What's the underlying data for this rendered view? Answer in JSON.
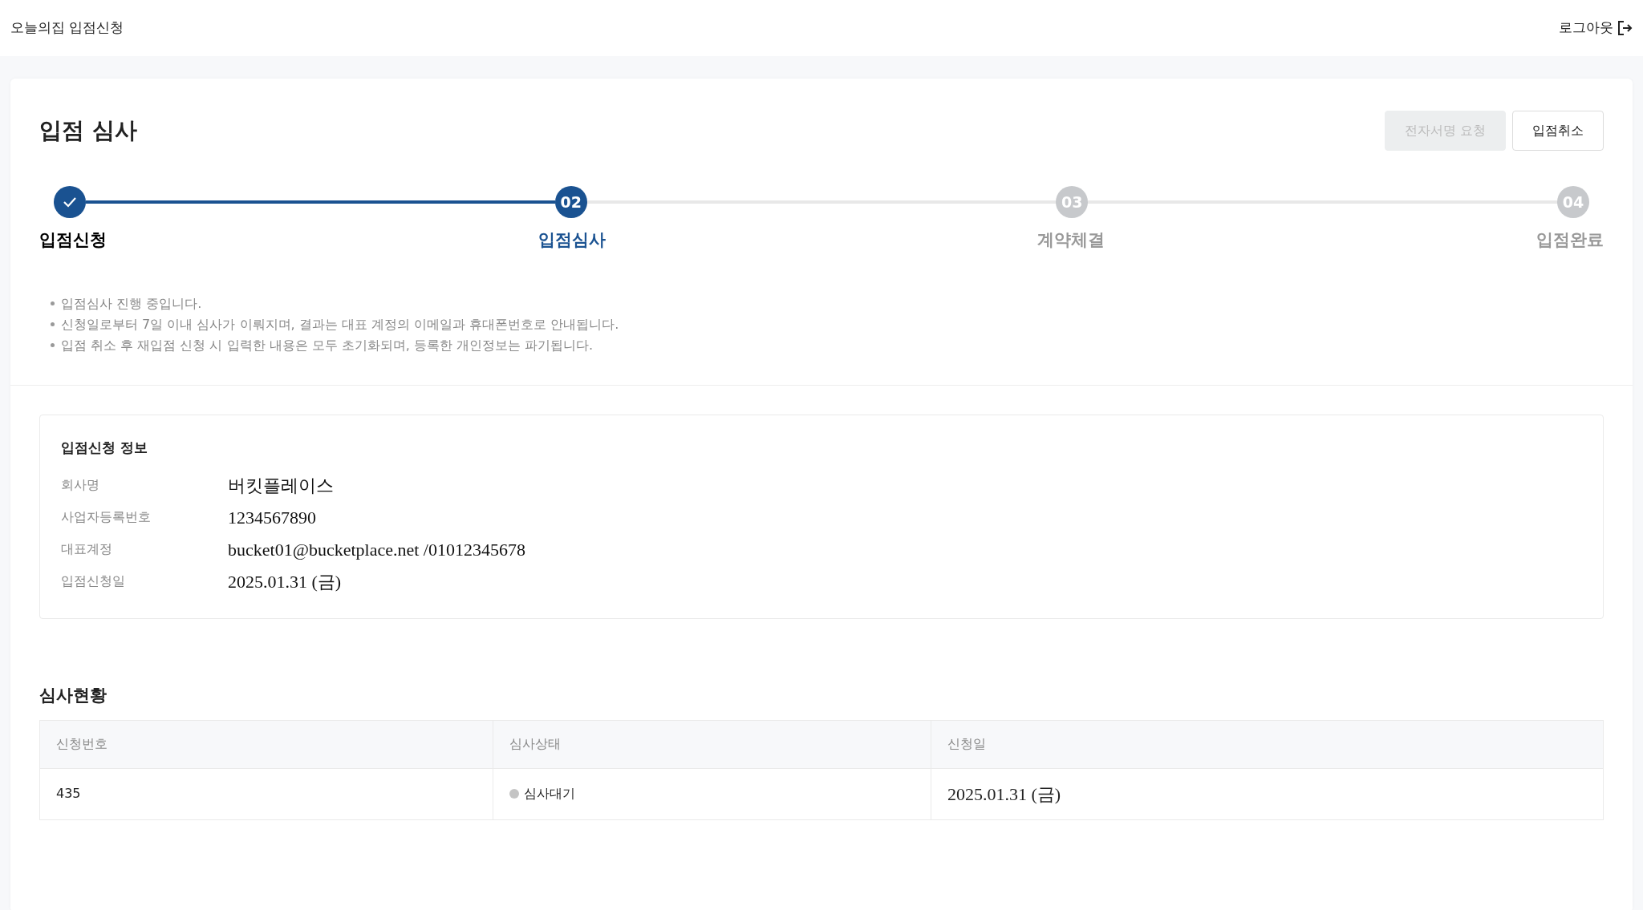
{
  "header": {
    "title": "오늘의집 입점신청",
    "logout": "로그아웃"
  },
  "page": {
    "title": "입점 심사",
    "buttons": [
      {
        "label": "전자서명 요청",
        "disabled": true
      },
      {
        "label": "입점취소",
        "disabled": false
      }
    ]
  },
  "steps": [
    {
      "label": "입점신청",
      "completed": true,
      "selected": false
    },
    {
      "number": "02",
      "label": "입점심사",
      "completed": false,
      "selected": true
    },
    {
      "number": "03",
      "label": "계약체결",
      "completed": false,
      "selected": false
    },
    {
      "number": "04",
      "label": "입점완료",
      "completed": false,
      "selected": false
    }
  ],
  "notes": [
    "입점심사 진행 중입니다.",
    "신청일로부터 7일 이내 심사가 이뤄지며, 결과는 대표 계정의 이메일과 휴대폰번호로 안내됩니다.",
    "입점 취소 후 재입점 신청 시 입력한 내용은 모두 초기화되며, 등록한 개인정보는 파기됩니다."
  ],
  "info": {
    "title": "입점신청 정보",
    "fields": [
      {
        "label": "회사명",
        "value": "버킷플레이스"
      },
      {
        "label": "사업자등록번호",
        "value": "1234567890"
      },
      {
        "label": "대표계정",
        "value": "bucket01@bucketplace.net /01012345678"
      },
      {
        "label": "입점신청일",
        "value": "2025.01.31 (금)"
      }
    ]
  },
  "review": {
    "title": "심사현황",
    "columns": [
      "신청번호",
      "심사상태",
      "신청일"
    ],
    "rows": [
      {
        "number": "435",
        "status": "심사대기",
        "color": "#c4c4c4",
        "date": "2025.01.31 (금)"
      }
    ]
  }
}
